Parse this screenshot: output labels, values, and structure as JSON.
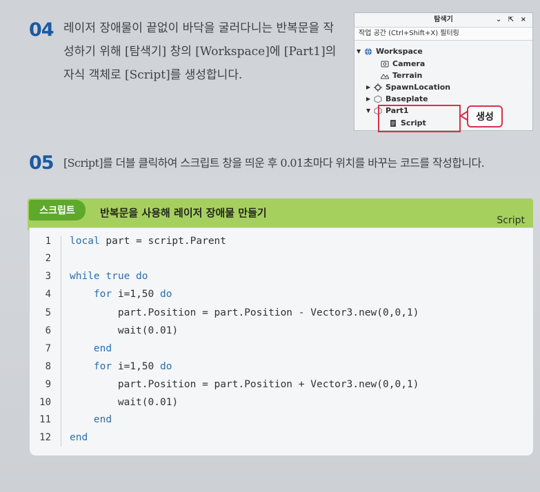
{
  "step04": {
    "number": "04",
    "lines": [
      "레이저 장애물이 끝없이 바닥을 굴러다니는 반복문을 작",
      "성하기 위해 [탐색기] 창의 [Workspace]에 [Part1]의",
      "자식 객체로 [Script]를 생성합니다."
    ]
  },
  "explorer": {
    "title": "탐색기",
    "window_controls": "⌄ ⇱ ×",
    "filter": "작업 공간 (Ctrl+Shift+X) 필터링",
    "items": [
      {
        "label": "Workspace",
        "icon": "globe-icon"
      },
      {
        "label": "Camera",
        "icon": "camera-icon"
      },
      {
        "label": "Terrain",
        "icon": "terrain-icon"
      },
      {
        "label": "SpawnLocation",
        "icon": "spawn-icon"
      },
      {
        "label": "Baseplate",
        "icon": "part-icon"
      },
      {
        "label": "Part1",
        "icon": "part-icon"
      },
      {
        "label": "Script",
        "icon": "script-icon"
      }
    ],
    "callout": "생성",
    "highlight_color": "#d6314a"
  },
  "step05": {
    "number": "05",
    "text": "[Script]를 더블 클릭하여 스크립트 창을 띄운 후 0.01초마다 위치를 바꾸는 코드를 작성합니다."
  },
  "script_box": {
    "tag": "스크립트",
    "title": "반복문을 사용해 레이저 장애물 만들기",
    "label": "Script",
    "accent": "#a6d05e",
    "tag_color": "#5ea82b",
    "lines": [
      {
        "n": "1",
        "code": "local part = script.Parent"
      },
      {
        "n": "2",
        "code": ""
      },
      {
        "n": "3",
        "code": "while true do"
      },
      {
        "n": "4",
        "code": "    for i=1,50 do"
      },
      {
        "n": "5",
        "code": "        part.Position = part.Position - Vector3.new(0,0,1)"
      },
      {
        "n": "6",
        "code": "        wait(0.01)"
      },
      {
        "n": "7",
        "code": "    end"
      },
      {
        "n": "8",
        "code": "    for i=1,50 do"
      },
      {
        "n": "9",
        "code": "        part.Position = part.Position + Vector3.new(0,0,1)"
      },
      {
        "n": "10",
        "code": "        wait(0.01)"
      },
      {
        "n": "11",
        "code": "    end"
      },
      {
        "n": "12",
        "code": "end"
      }
    ]
  }
}
